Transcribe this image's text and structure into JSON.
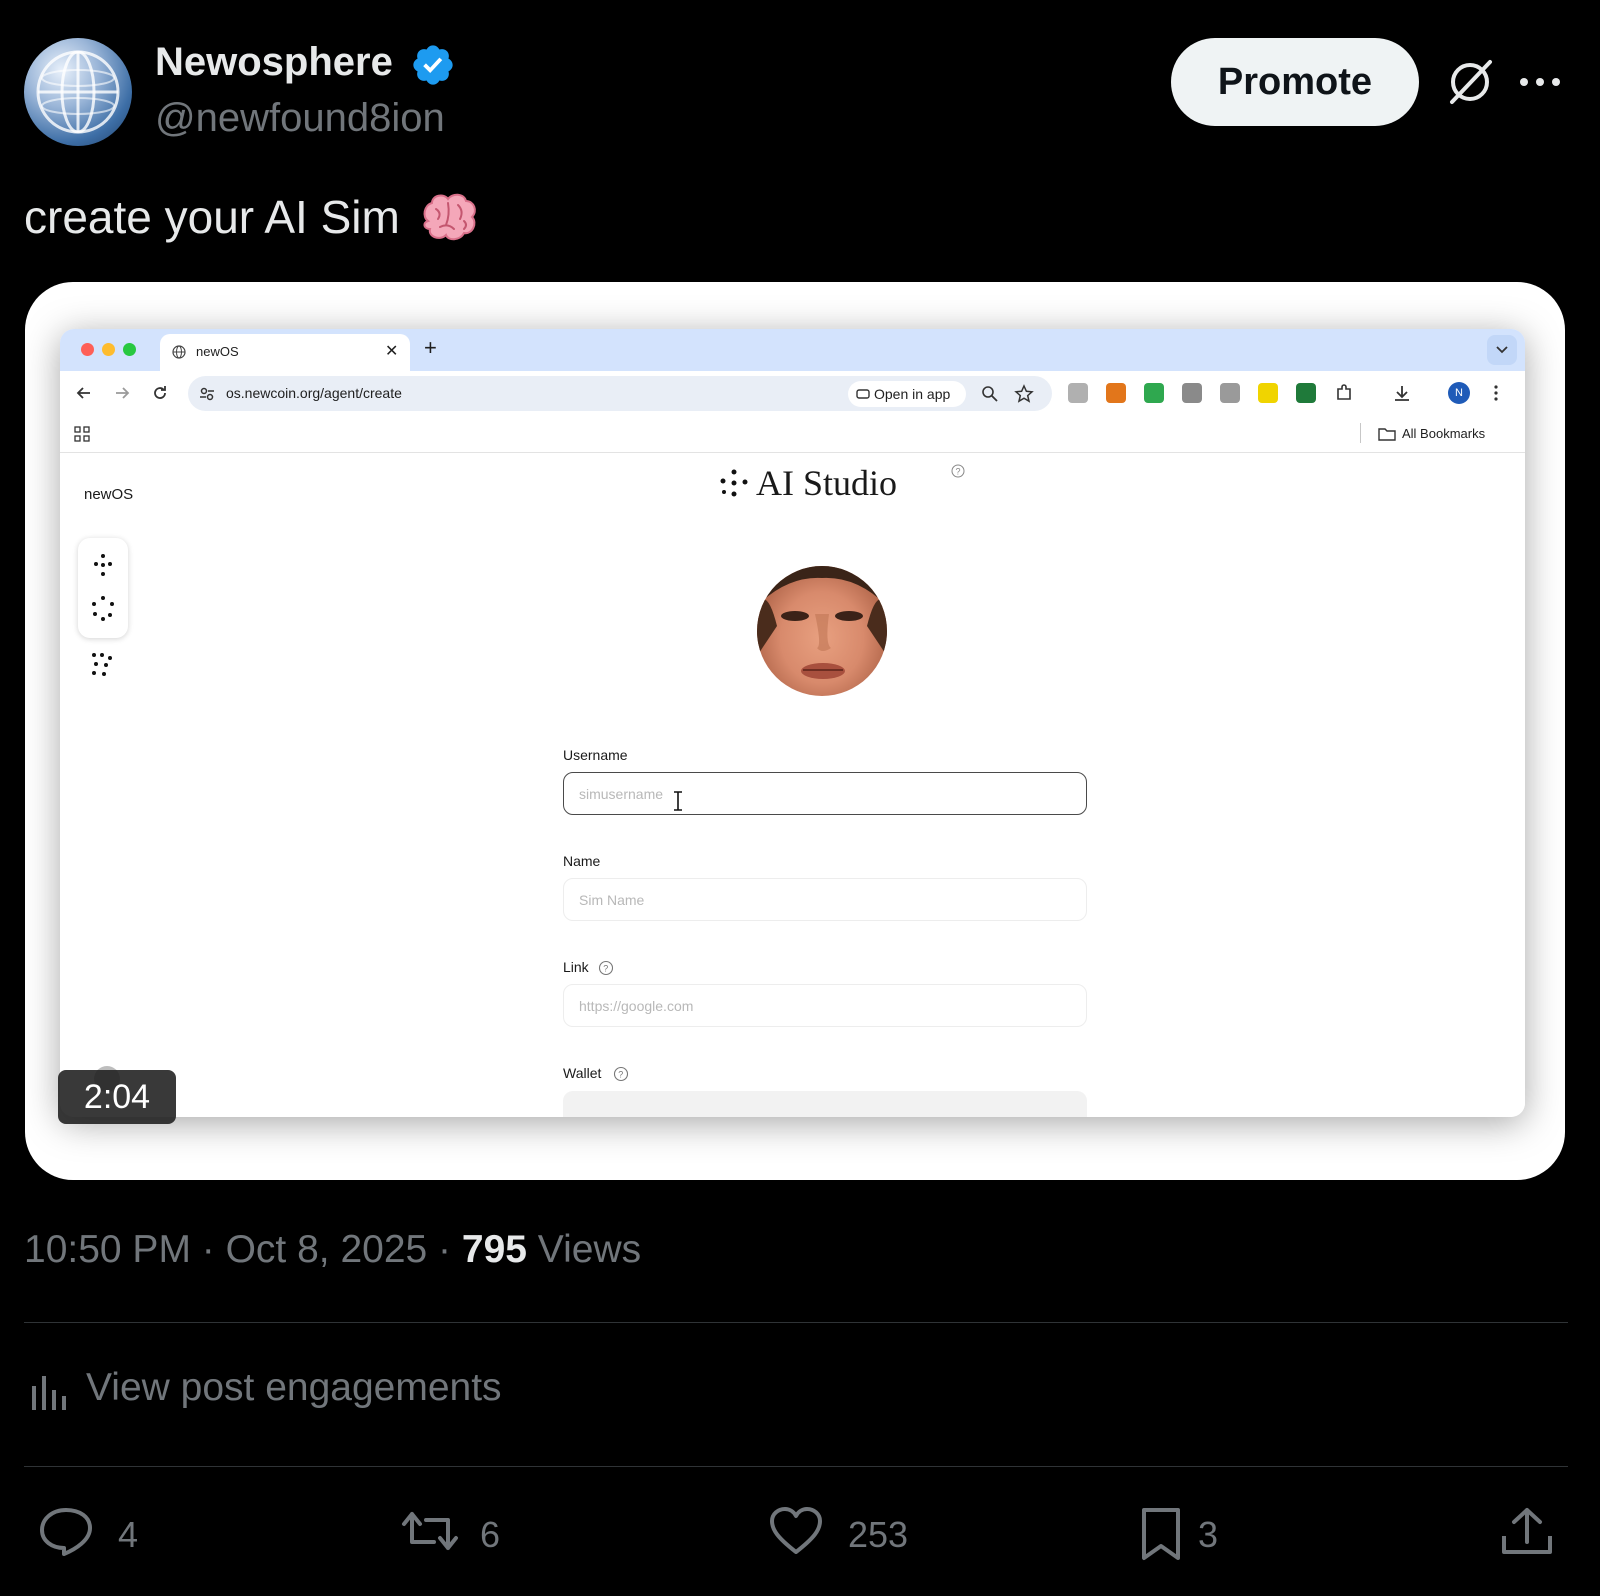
{
  "post": {
    "author": {
      "display_name": "Newosphere",
      "handle": "@newfound8ion",
      "verified": true
    },
    "promote_label": "Promote",
    "text": "create your AI Sim",
    "text_emoji": "brain-icon",
    "timestamp": "10:50 PM · Oct 8, 2025 · ",
    "views_count": "795",
    "views_label": " Views",
    "engagements_label": "View post engagements",
    "actions": {
      "replies": "4",
      "reposts": "6",
      "likes": "253",
      "bookmarks": "3"
    }
  },
  "video": {
    "duration": "2:04",
    "browser": {
      "tab_title": "newOS",
      "url": "os.newcoin.org/agent/create",
      "open_in_app_label": "Open in app",
      "bookmarks_label": "All Bookmarks",
      "profile_initial": "N"
    },
    "app": {
      "sidebar_label": "newOS",
      "brand": "AI Studio",
      "fields": [
        {
          "label": "Username",
          "placeholder": "simusername"
        },
        {
          "label": "Name",
          "placeholder": "Sim Name"
        },
        {
          "label": "Link",
          "placeholder": "https://google.com"
        },
        {
          "label": "Wallet"
        }
      ]
    }
  },
  "colors": {
    "background": "#000000",
    "verified_badge": "#1d9bf0",
    "muted_text": "#71767b",
    "primary_text": "#e7e9ea"
  }
}
